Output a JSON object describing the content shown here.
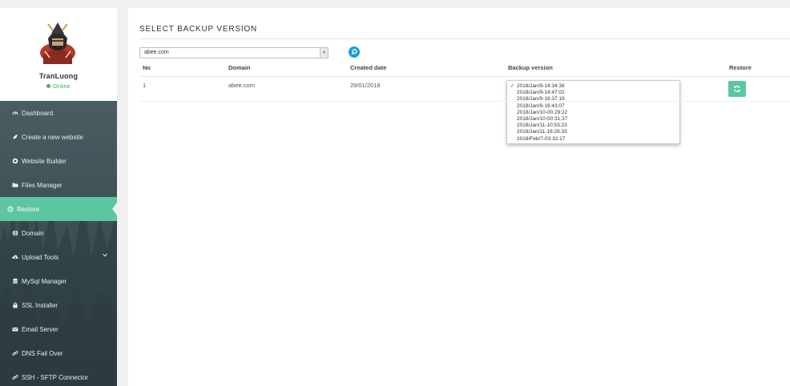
{
  "user": {
    "name": "TranLuong",
    "status": "Online"
  },
  "menu": [
    {
      "label": "Dashboard",
      "icon": "dashboard-icon"
    },
    {
      "label": "Create a new website",
      "icon": "rocket-icon"
    },
    {
      "label": "Website Builder",
      "icon": "builder-icon"
    },
    {
      "label": "Files Manager",
      "icon": "folder-icon"
    },
    {
      "label": "Restore",
      "icon": "restore-icon",
      "active": true
    },
    {
      "label": "Domain",
      "icon": "globe-icon"
    },
    {
      "label": "Upload Tools",
      "icon": "upload-icon",
      "expandable": true
    },
    {
      "label": "MySql Manager",
      "icon": "database-icon"
    },
    {
      "label": "SSL Installer",
      "icon": "lock-icon"
    },
    {
      "label": "Email Server",
      "icon": "envelope-icon"
    },
    {
      "label": "DNS Fail Over",
      "icon": "link-icon"
    },
    {
      "label": "SSH - SFTP Connector",
      "icon": "link-icon"
    }
  ],
  "page": {
    "title": "SELECT BACKUP VERSION",
    "domain_select": {
      "value": "abee.com"
    }
  },
  "table": {
    "headers": {
      "no": "No",
      "domain": "Domain",
      "created": "Created date",
      "version": "Backup version",
      "restore": "Restore"
    },
    "row": {
      "no": "1",
      "domain": "abee.com",
      "created": "29/01/2018",
      "versions": [
        "2018/Jan/9-14:34:38",
        "2018/Jan/9-14:47:02",
        "2018/Jan/9-16:37:19",
        "2018/Jan/9-16:43:07",
        "2018/Jan/10-00:29:22",
        "2018/Jan/10-00:31:37",
        "2018/Jan/11-10:53:23",
        "2018/Jan/11-16:26:33",
        "2018/Feb/7-03:32:17"
      ],
      "selected_version_index": 0
    }
  },
  "colors": {
    "accent": "#5cc6a3",
    "search": "#1a9fd8",
    "online": "#4caf50",
    "sidebar": "#3c4f54"
  }
}
